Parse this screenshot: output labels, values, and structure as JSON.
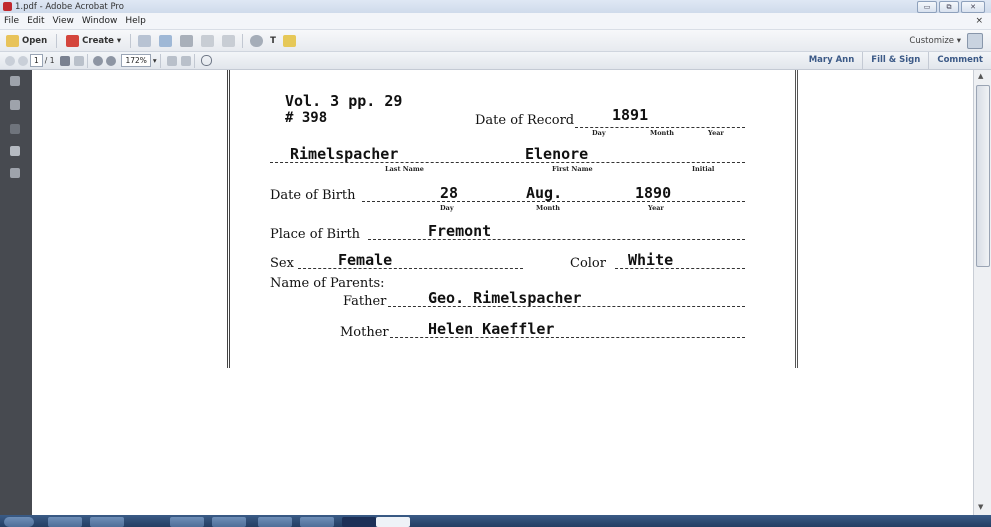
{
  "window": {
    "title": "1.pdf - Adobe Acrobat Pro",
    "min": "▭",
    "max": "⧉",
    "close": "✕"
  },
  "menu": {
    "items": [
      "File",
      "Edit",
      "View",
      "Window",
      "Help"
    ],
    "close": "×"
  },
  "toolbar": {
    "open": "Open",
    "create": "Create ▾",
    "customize": "Customize ▾"
  },
  "nav": {
    "page_current": "1",
    "page_total": "/ 1",
    "zoom": "172%"
  },
  "right_links": [
    "Mary Ann",
    "Fill & Sign",
    "Comment"
  ],
  "document": {
    "vol": "Vol. 3 pp. 29",
    "number": "# 398",
    "date_of_record_label": "Date of Record",
    "record_year": "1891",
    "sub_day": "Day",
    "sub_month": "Month",
    "sub_year": "Year",
    "last_name": "Rimelspacher",
    "first_name": "Elenore",
    "sub_last_name": "Last Name",
    "sub_first_name": "First Name",
    "sub_initial": "Initial",
    "dob_label": "Date of Birth",
    "dob_day": "28",
    "dob_month": "Aug.",
    "dob_year": "1890",
    "sub_day2": "Day",
    "sub_month2": "Month",
    "sub_year2": "Year",
    "pob_label": "Place of Birth",
    "pob": "Fremont",
    "sex_label": "Sex",
    "sex": "Female",
    "color_label": "Color",
    "color": "White",
    "parents_label": "Name of Parents:",
    "father_label": "Father",
    "father": "Geo. Rimelspacher",
    "mother_label": "Mother",
    "mother": "Helen Kaeffler"
  }
}
